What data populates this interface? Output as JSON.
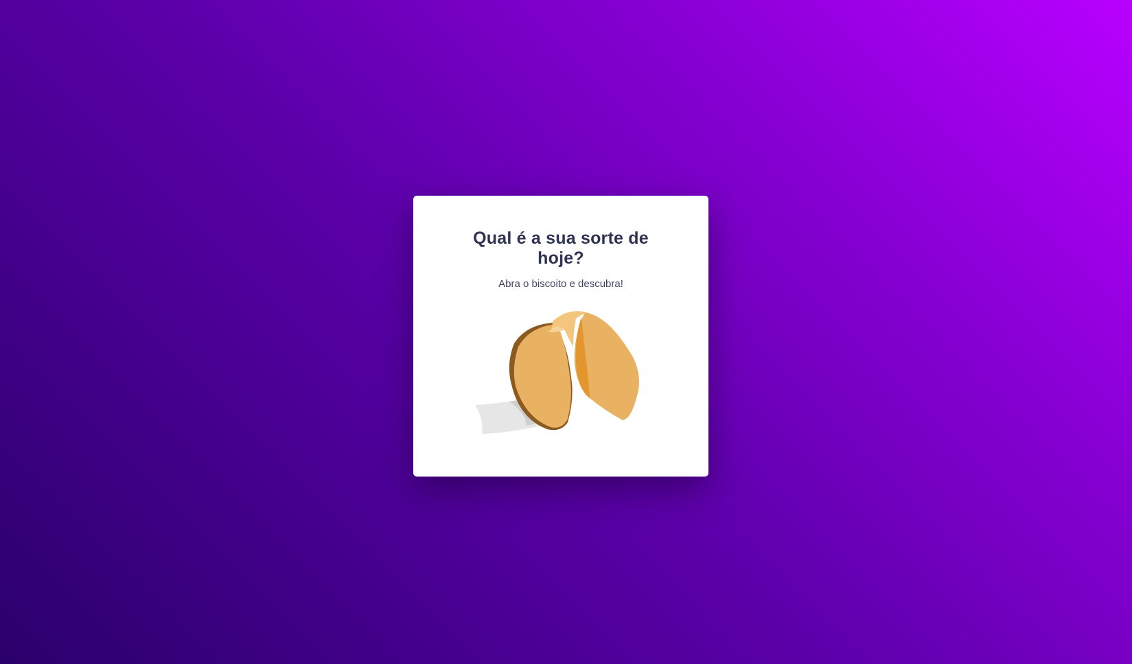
{
  "card": {
    "title": "Qual é a sua sorte de hoje?",
    "subtitle": "Abra o biscoito e descubra!",
    "image_icon": "fortune-cookie-icon"
  },
  "colors": {
    "background_start": "#2a006b",
    "background_end": "#b800ff",
    "card_background": "#ffffff",
    "title_color": "#2f3353",
    "cookie_main": "#e9b262",
    "cookie_dark": "#8a5a20",
    "cookie_inner": "#e3962e",
    "paper": "#e4e4e4"
  }
}
